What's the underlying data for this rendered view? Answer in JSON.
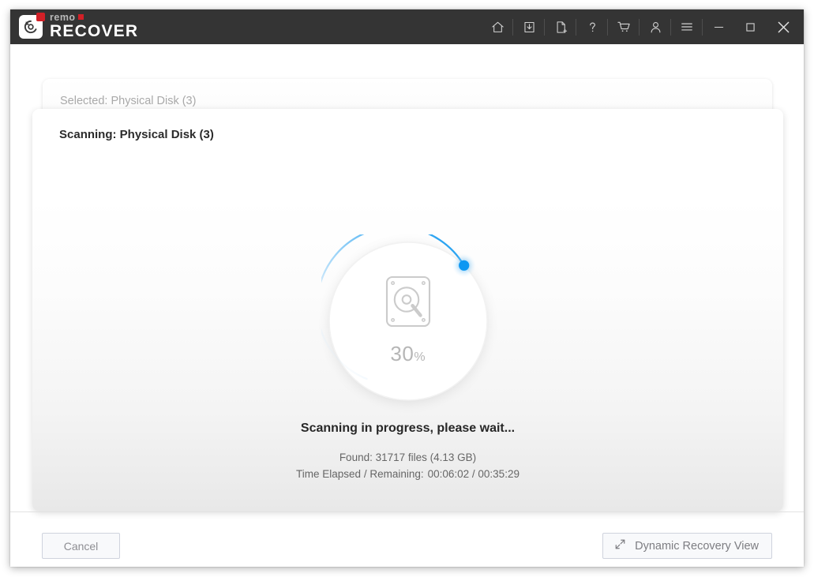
{
  "app": {
    "logo_remo": "remo",
    "logo_recover": "RECOVER"
  },
  "titlebar": {
    "icons": [
      {
        "name": "home-icon",
        "label": "Home"
      },
      {
        "name": "download-icon",
        "label": "Save/Download"
      },
      {
        "name": "new-file-icon",
        "label": "New File"
      },
      {
        "name": "help-icon",
        "label": "Help"
      },
      {
        "name": "cart-icon",
        "label": "Cart"
      },
      {
        "name": "user-icon",
        "label": "Account"
      },
      {
        "name": "menu-icon",
        "label": "Menu"
      }
    ],
    "window_controls": [
      {
        "name": "minimize-button",
        "label": "Minimize"
      },
      {
        "name": "maximize-button",
        "label": "Maximize"
      },
      {
        "name": "close-button",
        "label": "Close"
      }
    ]
  },
  "cards": {
    "selected_label": "Selected: Physical Disk (3)",
    "scanning_label": "Scanning: Physical Disk (3)"
  },
  "progress": {
    "percent": 30,
    "percent_number": "30",
    "percent_symbol": "%",
    "arc_color_bright": "#1a9cf0",
    "arc_color_fade": "#cfe7fa",
    "knob_color": "#0d97f2",
    "icon": "hard-disk-scan-icon"
  },
  "status": {
    "heading": "Scanning in progress, please wait...",
    "found": "Found: 31717 files (4.13 GB)",
    "time_label": "Time Elapsed / Remaining:",
    "time_value": "00:06:02 / 00:35:29"
  },
  "footer": {
    "cancel_label": "Cancel",
    "dynamic_label": "Dynamic Recovery View",
    "dynamic_icon": "expand-diagonal-icon"
  }
}
